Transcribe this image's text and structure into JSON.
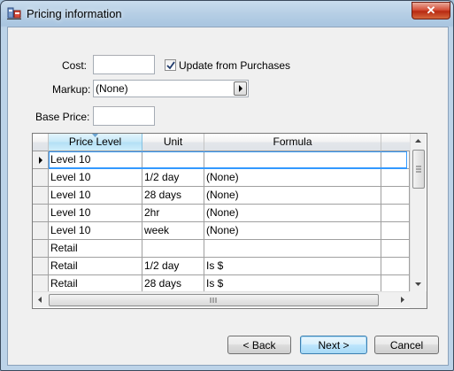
{
  "window": {
    "title": "Pricing information",
    "close_label": "✕"
  },
  "form": {
    "cost_label": "Cost:",
    "cost_value": "",
    "update_from_purchases_label": "Update from Purchases",
    "update_from_purchases_checked": true,
    "markup_label": "Markup:",
    "markup_value": "(None)",
    "base_price_label": "Base Price:",
    "base_price_value": ""
  },
  "grid": {
    "columns": [
      "Price Level",
      "Unit",
      "Formula"
    ],
    "rows": [
      {
        "level": "Level 10",
        "unit": "",
        "formula": ""
      },
      {
        "level": "Level 10",
        "unit": "1/2 day",
        "formula": "(None)"
      },
      {
        "level": "Level 10",
        "unit": "28 days",
        "formula": "(None)"
      },
      {
        "level": "Level 10",
        "unit": "2hr",
        "formula": "(None)"
      },
      {
        "level": "Level 10",
        "unit": "week",
        "formula": "(None)"
      },
      {
        "level": "Retail",
        "unit": "",
        "formula": ""
      },
      {
        "level": "Retail",
        "unit": "1/2 day",
        "formula": "Is $"
      },
      {
        "level": "Retail",
        "unit": "28 days",
        "formula": "Is $"
      }
    ]
  },
  "buttons": {
    "back": "< Back",
    "next": "Next >",
    "cancel": "Cancel"
  }
}
